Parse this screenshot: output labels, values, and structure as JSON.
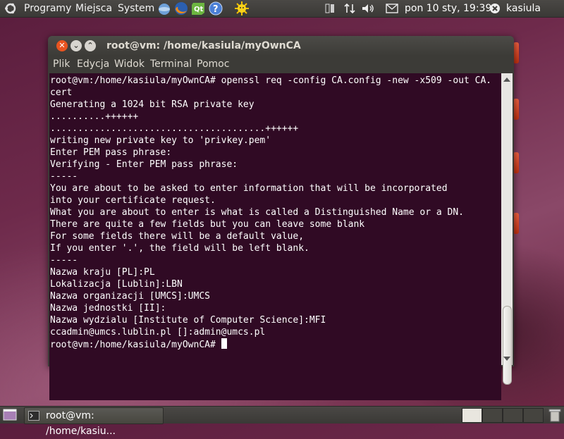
{
  "top_panel": {
    "menus": [
      "Programy",
      "Miejsca",
      "System"
    ],
    "clock": "pon 10 sty, 19:39",
    "user": "kasiula",
    "launchers": [
      "network-icon",
      "firefox-icon",
      "qt-icon",
      "help-icon",
      "sun-icon"
    ]
  },
  "window": {
    "title": "root@vm: /home/kasiula/myOwnCA",
    "menu": [
      "Plik",
      "Edycja",
      "Widok",
      "Terminal",
      "Pomoc"
    ],
    "terminal_lines": [
      "root@vm:/home/kasiula/myOwnCA# openssl req -config CA.config -new -x509 -out CA.",
      "cert",
      "Generating a 1024 bit RSA private key",
      "..........++++++",
      ".......................................++++++",
      "writing new private key to 'privkey.pem'",
      "Enter PEM pass phrase:",
      "Verifying - Enter PEM pass phrase:",
      "-----",
      "You are about to be asked to enter information that will be incorporated",
      "into your certificate request.",
      "What you are about to enter is what is called a Distinguished Name or a DN.",
      "There are quite a few fields but you can leave some blank",
      "For some fields there will be a default value,",
      "If you enter '.', the field will be left blank.",
      "-----",
      "Nazwa kraju [PL]:PL",
      "Lokalizacja [Lublin]:LBN",
      "Nazwa organizacji [UMCS]:UMCS",
      "Nazwa jednostki [II]:",
      "Nazwa wydzialu [Institute of Computer Science]:MFI",
      "ccadmin@umcs.lublin.pl []:admin@umcs.pl"
    ],
    "prompt": "root@vm:/home/kasiula/myOwnCA# "
  },
  "taskbar": {
    "task_label": "root@vm: /home/kasiu..."
  },
  "colors": {
    "terminal_bg": "#300a24",
    "panel_bg": "#3c3b37",
    "close_button": "#e95420"
  }
}
